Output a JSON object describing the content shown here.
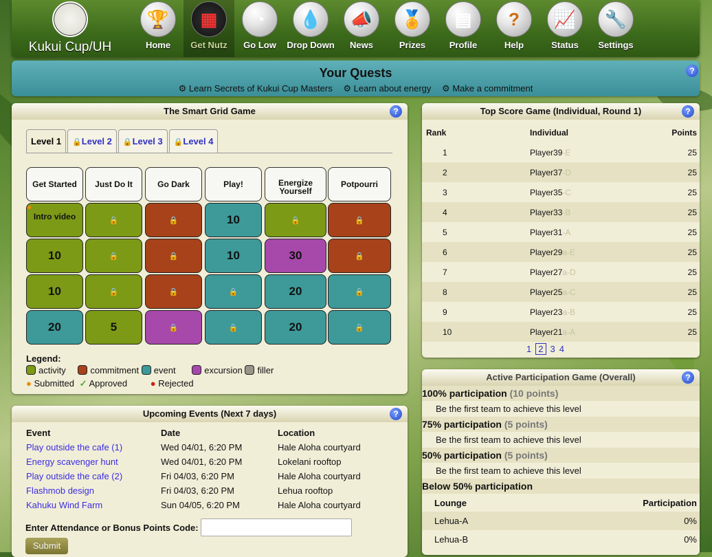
{
  "nav": {
    "brand": "Kukui Cup/UH",
    "items": [
      {
        "label": "Home",
        "icon": "trophy-icon"
      },
      {
        "label": "Get Nutz",
        "icon": "scoreboard-icon"
      },
      {
        "label": "Go Low",
        "icon": "gauge-icon"
      },
      {
        "label": "Drop Down",
        "icon": "water-drop-icon"
      },
      {
        "label": "News",
        "icon": "megaphone-icon"
      },
      {
        "label": "Prizes",
        "icon": "medal-icon"
      },
      {
        "label": "Profile",
        "icon": "profile-card-icon"
      },
      {
        "label": "Help",
        "icon": "question-icon"
      },
      {
        "label": "Status",
        "icon": "chart-icon"
      },
      {
        "label": "Settings",
        "icon": "wrench-icon"
      }
    ]
  },
  "quests": {
    "title": "Your Quests",
    "links": [
      "Learn Secrets of Kukui Cup Masters",
      "Learn about energy",
      "Make a commitment"
    ]
  },
  "smart_grid": {
    "title": "The Smart Grid Game",
    "tabs": [
      "Level 1",
      "Level 2",
      "Level 3",
      "Level 4"
    ],
    "columns": [
      "Get Started",
      "Just Do It",
      "Go Dark",
      "Play!",
      "Energize Yourself",
      "Potpourri"
    ],
    "rows": [
      [
        {
          "type": "activity",
          "text": "Intro video",
          "status": "submitted"
        },
        {
          "type": "activity",
          "text": ""
        },
        {
          "type": "commitment",
          "text": ""
        },
        {
          "type": "event",
          "text": "10"
        },
        {
          "type": "activity",
          "text": ""
        },
        {
          "type": "commitment",
          "text": ""
        }
      ],
      [
        {
          "type": "activity",
          "text": "10"
        },
        {
          "type": "activity",
          "text": ""
        },
        {
          "type": "commitment",
          "text": ""
        },
        {
          "type": "event",
          "text": "10"
        },
        {
          "type": "excursion",
          "text": "30"
        },
        {
          "type": "commitment",
          "text": ""
        }
      ],
      [
        {
          "type": "activity",
          "text": "10"
        },
        {
          "type": "activity",
          "text": ""
        },
        {
          "type": "commitment",
          "text": ""
        },
        {
          "type": "event",
          "text": ""
        },
        {
          "type": "event",
          "text": "20"
        },
        {
          "type": "event",
          "text": ""
        }
      ],
      [
        {
          "type": "event",
          "text": "20"
        },
        {
          "type": "activity",
          "text": "5"
        },
        {
          "type": "excursion",
          "text": ""
        },
        {
          "type": "event",
          "text": ""
        },
        {
          "type": "event",
          "text": "20"
        },
        {
          "type": "event",
          "text": ""
        }
      ]
    ],
    "legend": {
      "title": "Legend:",
      "types": [
        "activity",
        "commitment",
        "event",
        "excursion",
        "filler"
      ],
      "statuses": [
        "Submitted",
        "Approved",
        "Rejected"
      ]
    },
    "colors": {
      "activity": "#7c9a16",
      "commitment": "#a8421a",
      "event": "#3d9a99",
      "excursion": "#a748ab",
      "filler": "#9a958a"
    }
  },
  "top_score": {
    "title": "Top Score Game (Individual, Round 1)",
    "headers": [
      "Rank",
      "Individual",
      "Points"
    ],
    "rows": [
      {
        "rank": "1",
        "name": "Player39",
        "ghost": "-E",
        "points": "25"
      },
      {
        "rank": "2",
        "name": "Player37",
        "ghost": "-D",
        "points": "25"
      },
      {
        "rank": "3",
        "name": "Player35",
        "ghost": "-C",
        "points": "25"
      },
      {
        "rank": "4",
        "name": "Player33",
        "ghost": "-B",
        "points": "25"
      },
      {
        "rank": "5",
        "name": "Player31",
        "ghost": "-A",
        "points": "25"
      },
      {
        "rank": "6",
        "name": "Player29",
        "ghost": "a-E",
        "points": "25"
      },
      {
        "rank": "7",
        "name": "Player27",
        "ghost": "a-D",
        "points": "25"
      },
      {
        "rank": "8",
        "name": "Player25",
        "ghost": "a-C",
        "points": "25"
      },
      {
        "rank": "9",
        "name": "Player23",
        "ghost": "a-B",
        "points": "25"
      },
      {
        "rank": "10",
        "name": "Player21",
        "ghost": "a-A",
        "points": "25"
      }
    ],
    "pages": [
      "1",
      "2",
      "3",
      "4"
    ],
    "current_page": "2"
  },
  "events": {
    "title": "Upcoming Events (Next 7 days)",
    "headers": [
      "Event",
      "Date",
      "Location"
    ],
    "rows": [
      {
        "event": "Play outside the cafe (1)",
        "date": "Wed 04/01, 6:20 PM",
        "location": "Hale Aloha courtyard"
      },
      {
        "event": "Energy scavenger hunt",
        "date": "Wed 04/01, 6:20 PM",
        "location": "Lokelani rooftop"
      },
      {
        "event": "Play outside the cafe (2)",
        "date": "Fri 04/03, 6:20 PM",
        "location": "Hale Aloha courtyard"
      },
      {
        "event": "Flashmob design",
        "date": "Fri 04/03, 6:20 PM",
        "location": "Lehua rooftop"
      },
      {
        "event": "Kahuku Wind Farm",
        "date": "Sun 04/05, 6:20 PM",
        "location": "Hale Aloha courtyard"
      }
    ],
    "code_label": "Enter Attendance or Bonus Points Code:",
    "code_value": "",
    "submit_label": "Submit"
  },
  "participation": {
    "title": "Active Participation Game (Overall)",
    "levels": [
      {
        "label": "100% participation",
        "points": "(10 points)",
        "note": "Be the first team to achieve this level"
      },
      {
        "label": "75% participation",
        "points": "(5 points)",
        "note": "Be the first team to achieve this level"
      },
      {
        "label": "50% participation",
        "points": "(5 points)",
        "note": "Be the first team to achieve this level"
      }
    ],
    "below_label": "Below 50% participation",
    "headers": [
      "Lounge",
      "Participation"
    ],
    "rows": [
      {
        "lounge": "Lehua-A",
        "pct": "0%"
      },
      {
        "lounge": "Lehua-B",
        "pct": "0%"
      }
    ]
  }
}
